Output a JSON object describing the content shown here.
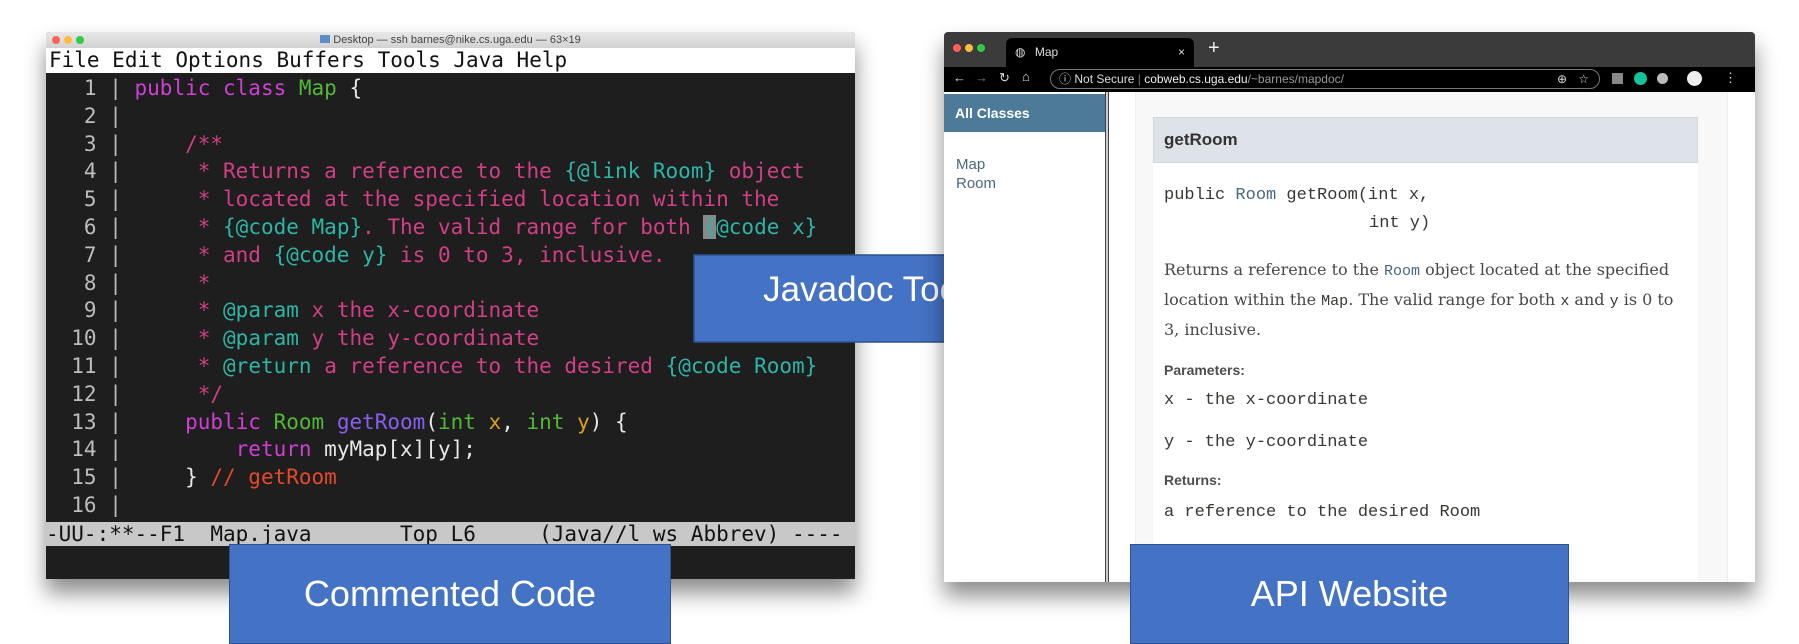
{
  "terminal": {
    "title": "Desktop — ssh barnes@nike.cs.uga.edu — 63×19",
    "menu": [
      "File",
      "Edit",
      "Options",
      "Buffers",
      "Tools",
      "Java",
      "Help"
    ],
    "lines": [
      [
        [
          "k",
          "public class "
        ],
        [
          "t",
          "Map"
        ],
        [
          "w",
          " {"
        ]
      ],
      [],
      [
        [
          "c",
          "    /**"
        ]
      ],
      [
        [
          "c",
          "     * Returns a reference to the "
        ],
        [
          "d",
          "{@link Room}"
        ],
        [
          "c",
          " object"
        ]
      ],
      [
        [
          "c",
          "     * located at the specified location within the"
        ]
      ],
      [
        [
          "c",
          "     * "
        ],
        [
          "d",
          "{@code Map}"
        ],
        [
          "c",
          ". The valid range for both "
        ],
        [
          "cur",
          "{"
        ],
        [
          "d",
          "@code x}"
        ]
      ],
      [
        [
          "c",
          "     * and "
        ],
        [
          "d",
          "{@code y}"
        ],
        [
          "c",
          " is 0 to 3, inclusive."
        ]
      ],
      [
        [
          "c",
          "     *"
        ]
      ],
      [
        [
          "c",
          "     * "
        ],
        [
          "d",
          "@param"
        ],
        [
          "c",
          " x the x-coordinate"
        ]
      ],
      [
        [
          "c",
          "     * "
        ],
        [
          "d",
          "@param"
        ],
        [
          "c",
          " y the y-coordinate"
        ]
      ],
      [
        [
          "c",
          "     * "
        ],
        [
          "d",
          "@return"
        ],
        [
          "c",
          " a reference to the desired "
        ],
        [
          "d",
          "{@code Room}"
        ]
      ],
      [
        [
          "c",
          "     */"
        ]
      ],
      [
        [
          "k",
          "    public "
        ],
        [
          "t",
          "Room "
        ],
        [
          "f",
          "getRoom"
        ],
        [
          "w",
          "("
        ],
        [
          "t",
          "int "
        ],
        [
          "p",
          "x"
        ],
        [
          "w",
          ", "
        ],
        [
          "t",
          "int "
        ],
        [
          "p",
          "y"
        ],
        [
          "w",
          ") {"
        ]
      ],
      [
        [
          "k",
          "        return "
        ],
        [
          "w",
          "myMap[x][y];"
        ]
      ],
      [
        [
          "w",
          "    } "
        ],
        [
          "r",
          "// getRoom"
        ]
      ],
      []
    ],
    "modeline": "-UU-:**--F1  Map.java       Top L6     (Java//l ws Abbrev) ----"
  },
  "arrow_label": "Javadoc Tool",
  "captions": {
    "left": "Commented Code",
    "right": "API Website"
  },
  "browser": {
    "tab_title": "Map",
    "not_secure": "Not Secure",
    "url_host": "cobweb.cs.uga.edu",
    "url_path": "/~barnes/mapdoc/",
    "sidebar_header": "All Classes",
    "classes": [
      "Map",
      "Room"
    ],
    "method_name": "getRoom",
    "signature": {
      "pre": "public ",
      "type": "Room",
      "post": " getRoom(int x,",
      "line2": "int y)"
    },
    "description": {
      "p1": "Returns a reference to the ",
      "room": "Room",
      "p2": " object located at the specified location within the ",
      "map": "Map",
      "p3": ". The valid range for both ",
      "x": "x",
      "p4": " and ",
      "y": "y",
      "p5": " is 0 to 3, inclusive."
    },
    "parameters_label": "Parameters:",
    "params": [
      "x - the x-coordinate",
      "y - the y-coordinate"
    ],
    "returns_label": "Returns:",
    "returns": "a reference to the desired Room"
  },
  "colors": {
    "caption_blue": "#4472c4",
    "javadoc_header": "#4d7a97"
  }
}
